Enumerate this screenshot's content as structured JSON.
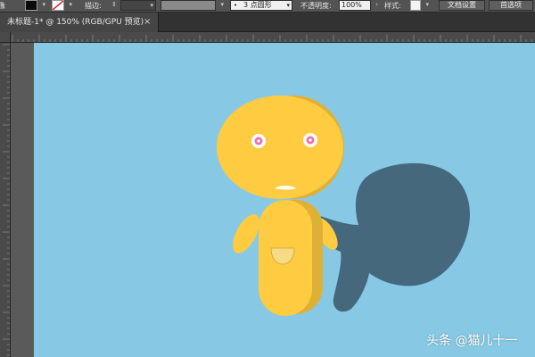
{
  "control_bar": {
    "left_fragment": "像",
    "fill_color": "#0a0a0a",
    "stroke_swatch": "none-swatch",
    "stroke_label": "描边:",
    "stroke_width_value": "",
    "stroke_style_preview_color": "#8a8a8a",
    "brush_label": "3 点圆形",
    "opacity_label": "不透明度:",
    "opacity_value": "100%",
    "style_label": "样式:",
    "doc_setup_button": "文档设置",
    "preferences_button": "首选项"
  },
  "document_tab": {
    "title": "未标题-1* @ 150% (RGB/GPU 预览)",
    "close_glyph": "×"
  },
  "artwork": {
    "background_color": "#87c9e5",
    "body_color": "#fecb41",
    "body_shade_color": "#dfb036",
    "shadow_color": "#46687c",
    "eye_ring_color": "#ffffff",
    "pupil_color": "#e676a8",
    "pocket_color": "#f7da84"
  },
  "watermark": "头条 @猫儿十一"
}
